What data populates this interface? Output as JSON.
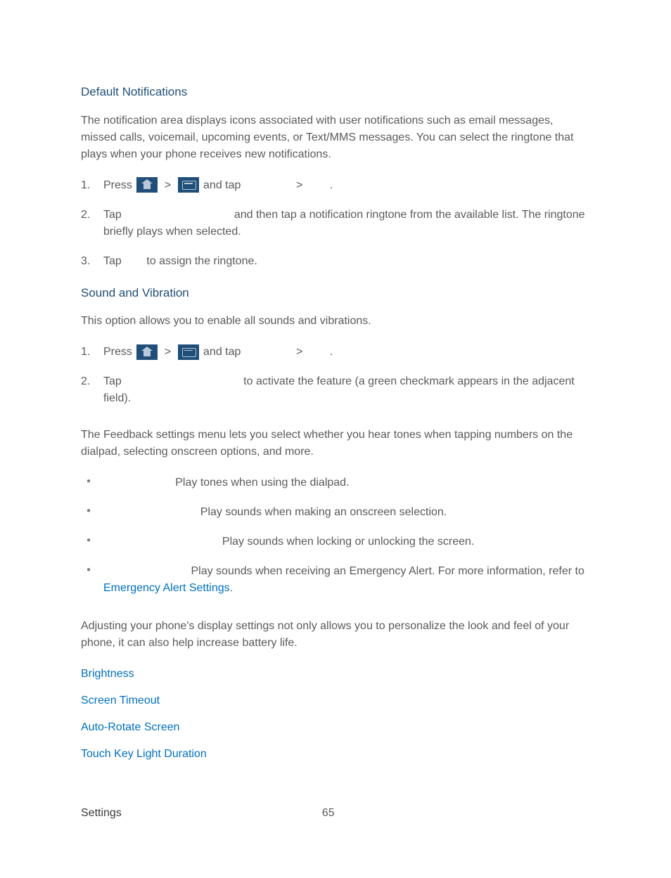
{
  "section1": {
    "heading": "Default Notifications",
    "para": "The notification area displays icons associated with user notifications such as email messages, missed calls, voicemail, upcoming events, or Text/MMS messages. You can select the ringtone that plays when your phone receives new notifications.",
    "steps": {
      "s1": {
        "num": "1.",
        "press": "Press ",
        "gt1": " > ",
        "andtap": " and tap ",
        "gt2": ">",
        "period": "."
      },
      "s2": {
        "num": "2.",
        "tap": "Tap ",
        "rest": " and then tap a notification ringtone from the available list. The ringtone briefly plays when selected."
      },
      "s3": {
        "num": "3.",
        "tap": "Tap ",
        "rest": " to assign the ringtone."
      }
    }
  },
  "section2": {
    "heading": "Sound and Vibration",
    "para": "This option allows you to enable all sounds and vibrations.",
    "steps": {
      "s1": {
        "num": "1.",
        "press": "Press ",
        "gt1": " > ",
        "andtap": " and tap ",
        "gt2": ">",
        "period": "."
      },
      "s2": {
        "num": "2.",
        "tap": "Tap ",
        "rest": " to activate the feature (a green checkmark appears in the adjacent field)."
      }
    }
  },
  "feedback": {
    "para": "The Feedback settings menu lets you select whether you hear tones when tapping numbers on the dialpad, selecting onscreen options, and more.",
    "b1": " Play tones when using the dialpad.",
    "b2": " Play sounds when making an onscreen selection.",
    "b3": " Play sounds when locking or unlocking the screen.",
    "b4a": " Play sounds when receiving an Emergency Alert. For more information, refer to ",
    "b4link": "Emergency Alert Settings",
    "b4b": "."
  },
  "display": {
    "para": "Adjusting your phone's display settings not only allows you to personalize the look and feel of your phone, it can also help increase battery life.",
    "links": {
      "l1": "Brightness",
      "l2": "Screen Timeout",
      "l3": "Auto-Rotate Screen",
      "l4": "Touch Key Light Duration"
    }
  },
  "footer": {
    "label": "Settings",
    "page": "65"
  }
}
